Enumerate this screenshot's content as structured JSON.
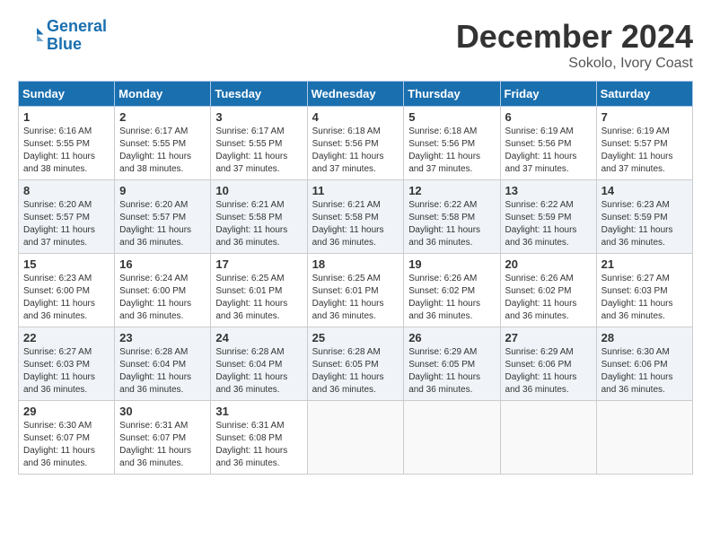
{
  "header": {
    "logo_line1": "General",
    "logo_line2": "Blue",
    "main_title": "December 2024",
    "subtitle": "Sokolo, Ivory Coast"
  },
  "calendar": {
    "days_of_week": [
      "Sunday",
      "Monday",
      "Tuesday",
      "Wednesday",
      "Thursday",
      "Friday",
      "Saturday"
    ],
    "weeks": [
      [
        null,
        null,
        null,
        null,
        null,
        null,
        null
      ]
    ]
  },
  "days": {
    "w1": [
      {
        "num": "1",
        "sunrise": "6:16 AM",
        "sunset": "5:55 PM",
        "daylight": "11 hours and 38 minutes."
      },
      {
        "num": "2",
        "sunrise": "6:17 AM",
        "sunset": "5:55 PM",
        "daylight": "11 hours and 38 minutes."
      },
      {
        "num": "3",
        "sunrise": "6:17 AM",
        "sunset": "5:55 PM",
        "daylight": "11 hours and 37 minutes."
      },
      {
        "num": "4",
        "sunrise": "6:18 AM",
        "sunset": "5:56 PM",
        "daylight": "11 hours and 37 minutes."
      },
      {
        "num": "5",
        "sunrise": "6:18 AM",
        "sunset": "5:56 PM",
        "daylight": "11 hours and 37 minutes."
      },
      {
        "num": "6",
        "sunrise": "6:19 AM",
        "sunset": "5:56 PM",
        "daylight": "11 hours and 37 minutes."
      },
      {
        "num": "7",
        "sunrise": "6:19 AM",
        "sunset": "5:57 PM",
        "daylight": "11 hours and 37 minutes."
      }
    ],
    "w2": [
      {
        "num": "8",
        "sunrise": "6:20 AM",
        "sunset": "5:57 PM",
        "daylight": "11 hours and 37 minutes."
      },
      {
        "num": "9",
        "sunrise": "6:20 AM",
        "sunset": "5:57 PM",
        "daylight": "11 hours and 36 minutes."
      },
      {
        "num": "10",
        "sunrise": "6:21 AM",
        "sunset": "5:58 PM",
        "daylight": "11 hours and 36 minutes."
      },
      {
        "num": "11",
        "sunrise": "6:21 AM",
        "sunset": "5:58 PM",
        "daylight": "11 hours and 36 minutes."
      },
      {
        "num": "12",
        "sunrise": "6:22 AM",
        "sunset": "5:58 PM",
        "daylight": "11 hours and 36 minutes."
      },
      {
        "num": "13",
        "sunrise": "6:22 AM",
        "sunset": "5:59 PM",
        "daylight": "11 hours and 36 minutes."
      },
      {
        "num": "14",
        "sunrise": "6:23 AM",
        "sunset": "5:59 PM",
        "daylight": "11 hours and 36 minutes."
      }
    ],
    "w3": [
      {
        "num": "15",
        "sunrise": "6:23 AM",
        "sunset": "6:00 PM",
        "daylight": "11 hours and 36 minutes."
      },
      {
        "num": "16",
        "sunrise": "6:24 AM",
        "sunset": "6:00 PM",
        "daylight": "11 hours and 36 minutes."
      },
      {
        "num": "17",
        "sunrise": "6:25 AM",
        "sunset": "6:01 PM",
        "daylight": "11 hours and 36 minutes."
      },
      {
        "num": "18",
        "sunrise": "6:25 AM",
        "sunset": "6:01 PM",
        "daylight": "11 hours and 36 minutes."
      },
      {
        "num": "19",
        "sunrise": "6:26 AM",
        "sunset": "6:02 PM",
        "daylight": "11 hours and 36 minutes."
      },
      {
        "num": "20",
        "sunrise": "6:26 AM",
        "sunset": "6:02 PM",
        "daylight": "11 hours and 36 minutes."
      },
      {
        "num": "21",
        "sunrise": "6:27 AM",
        "sunset": "6:03 PM",
        "daylight": "11 hours and 36 minutes."
      }
    ],
    "w4": [
      {
        "num": "22",
        "sunrise": "6:27 AM",
        "sunset": "6:03 PM",
        "daylight": "11 hours and 36 minutes."
      },
      {
        "num": "23",
        "sunrise": "6:28 AM",
        "sunset": "6:04 PM",
        "daylight": "11 hours and 36 minutes."
      },
      {
        "num": "24",
        "sunrise": "6:28 AM",
        "sunset": "6:04 PM",
        "daylight": "11 hours and 36 minutes."
      },
      {
        "num": "25",
        "sunrise": "6:28 AM",
        "sunset": "6:05 PM",
        "daylight": "11 hours and 36 minutes."
      },
      {
        "num": "26",
        "sunrise": "6:29 AM",
        "sunset": "6:05 PM",
        "daylight": "11 hours and 36 minutes."
      },
      {
        "num": "27",
        "sunrise": "6:29 AM",
        "sunset": "6:06 PM",
        "daylight": "11 hours and 36 minutes."
      },
      {
        "num": "28",
        "sunrise": "6:30 AM",
        "sunset": "6:06 PM",
        "daylight": "11 hours and 36 minutes."
      }
    ],
    "w5": [
      {
        "num": "29",
        "sunrise": "6:30 AM",
        "sunset": "6:07 PM",
        "daylight": "11 hours and 36 minutes."
      },
      {
        "num": "30",
        "sunrise": "6:31 AM",
        "sunset": "6:07 PM",
        "daylight": "11 hours and 36 minutes."
      },
      {
        "num": "31",
        "sunrise": "6:31 AM",
        "sunset": "6:08 PM",
        "daylight": "11 hours and 36 minutes."
      }
    ]
  },
  "labels": {
    "sunrise": "Sunrise:",
    "sunset": "Sunset:",
    "daylight": "Daylight:"
  }
}
